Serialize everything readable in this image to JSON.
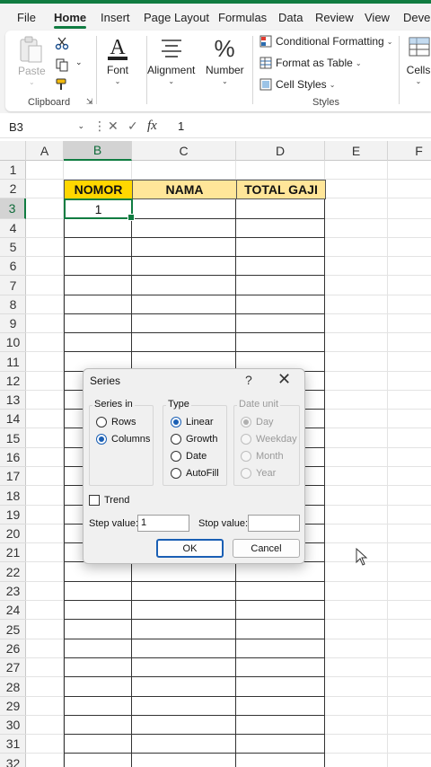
{
  "menu": {
    "tabs": [
      "File",
      "Home",
      "Insert",
      "Page Layout",
      "Formulas",
      "Data",
      "Review",
      "View",
      "Devel"
    ],
    "active": "Home"
  },
  "ribbon": {
    "clipboard": {
      "paste": "Paste",
      "label": "Clipboard"
    },
    "font": {
      "label": "Font"
    },
    "alignment": {
      "label": "Alignment"
    },
    "number": {
      "label": "Number"
    },
    "styles": {
      "conditional_formatting": "Conditional Formatting",
      "format_as_table": "Format as Table",
      "cell_styles": "Cell Styles",
      "label": "Styles"
    },
    "cells": {
      "label": "Cells"
    }
  },
  "formula_bar": {
    "name_box": "B3",
    "fx": "fx",
    "value": "1"
  },
  "grid": {
    "columns": [
      "A",
      "B",
      "C",
      "D",
      "E",
      "F"
    ],
    "selected_column": "B",
    "rows": [
      "1",
      "2",
      "3",
      "4",
      "5",
      "6",
      "7",
      "8",
      "9",
      "10",
      "11",
      "12",
      "13",
      "14",
      "15",
      "16",
      "17",
      "18",
      "19",
      "20",
      "21",
      "22",
      "23",
      "24",
      "25",
      "26",
      "27",
      "28",
      "29",
      "30",
      "31",
      "32"
    ],
    "selected_row": "3",
    "headers": {
      "nomor": "NOMOR",
      "nama": "NAMA",
      "total_gaji": "TOTAL GAJI"
    },
    "b3_value": "1"
  },
  "dialog": {
    "title": "Series",
    "help": "?",
    "close": "✕",
    "series_in": {
      "legend": "Series in",
      "rows": "Rows",
      "columns": "Columns",
      "selected": "Columns"
    },
    "type": {
      "legend": "Type",
      "linear": "Linear",
      "growth": "Growth",
      "date": "Date",
      "autofill": "AutoFill",
      "selected": "Linear"
    },
    "date_unit": {
      "legend": "Date unit",
      "day": "Day",
      "weekday": "Weekday",
      "month": "Month",
      "year": "Year",
      "selected": "Day",
      "enabled": false
    },
    "trend": {
      "label": "Trend",
      "checked": false
    },
    "step_value": {
      "label": "Step value:",
      "value": "1"
    },
    "stop_value": {
      "label": "Stop value:",
      "value": ""
    },
    "ok": "OK",
    "cancel": "Cancel"
  },
  "colors": {
    "accent": "#107c41",
    "header_yellow": "#ffd700",
    "header_light_yellow": "#ffe699",
    "radio_selected": "#1a5fb4"
  }
}
